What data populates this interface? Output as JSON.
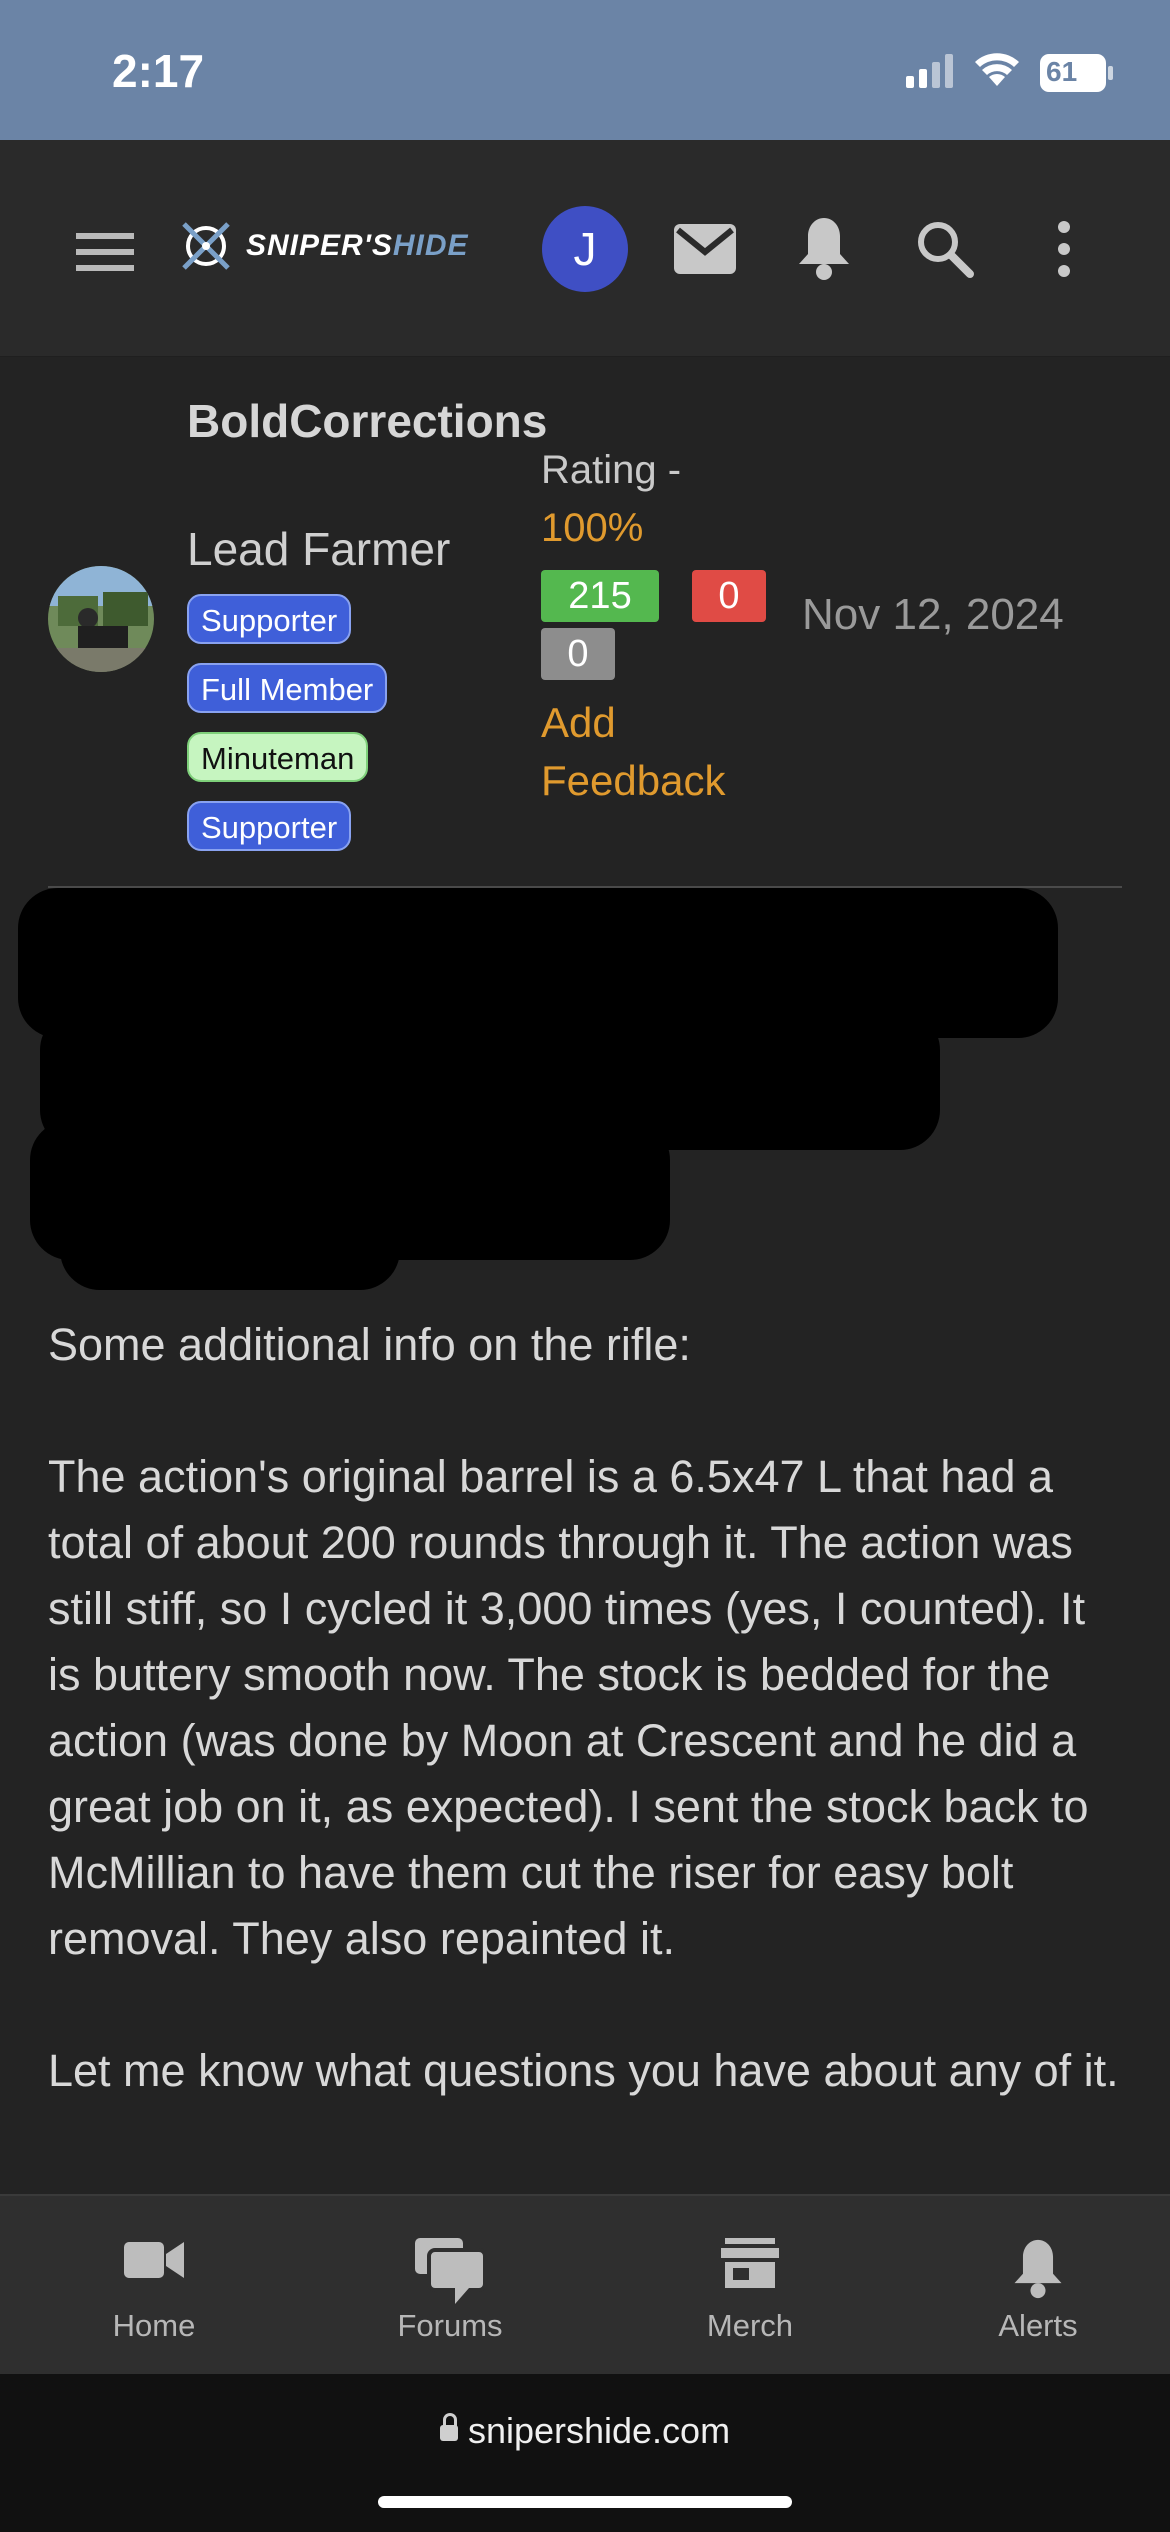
{
  "status_bar": {
    "time": "2:17",
    "battery": "61"
  },
  "site": {
    "logo_main": "SNIPER'S",
    "logo_hide": "HIDE",
    "avatar_letter": "J",
    "url": "snipershide.com"
  },
  "post": {
    "username": "BoldCorrections",
    "user_title": "Lead Farmer",
    "badges": [
      "Supporter",
      "Full Member",
      "Minuteman",
      "Supporter"
    ],
    "rating_label": "Rating -",
    "rating_pct": "100%",
    "feedback": {
      "positive": "215",
      "negative": "0",
      "neutral": "0"
    },
    "add_feedback": "Add Feedback",
    "date": "Nov 12, 2024",
    "body": [
      "Some additional info on the rifle:",
      "The action's original barrel is a 6.5x47 L that had a total of about 200 rounds through it. The action was still stiff, so I cycled it 3,000 times (yes, I counted). It is buttery smooth now. The stock is bedded for the action (was done by Moon at Crescent and he did a great job on it, as expected). I sent the stock back to McMillian to have them cut the riser for easy bolt removal. They also repainted it.",
      "Let me know what questions you have about any of it."
    ]
  },
  "tabs": [
    {
      "label": "Home",
      "icon": "video-camera-icon"
    },
    {
      "label": "Forums",
      "icon": "chat-bubbles-icon"
    },
    {
      "label": "Merch",
      "icon": "store-icon"
    },
    {
      "label": "Alerts",
      "icon": "bell-icon"
    }
  ],
  "colors": {
    "accent": "#e09a2e",
    "badge_blue": "#3f5fd9",
    "positive": "#54b84f",
    "negative": "#e04b45",
    "status_bar": "#6b84a6"
  }
}
